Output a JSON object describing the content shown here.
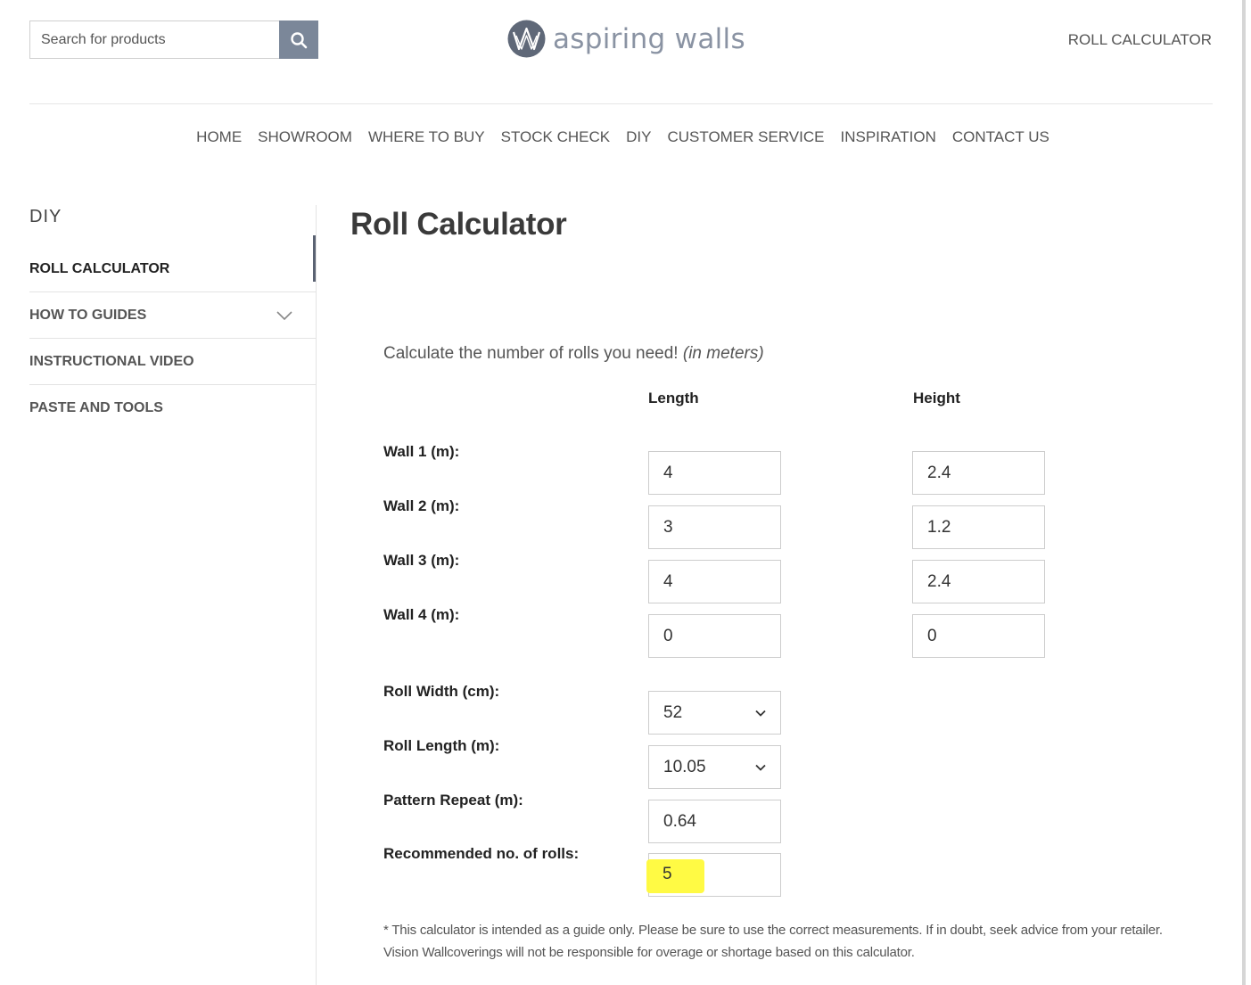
{
  "header": {
    "search_placeholder": "Search for products",
    "logo_text": "aspiring walls",
    "top_link": "ROLL CALCULATOR"
  },
  "nav": [
    "HOME",
    "SHOWROOM",
    "WHERE TO BUY",
    "STOCK CHECK",
    "DIY",
    "CUSTOMER SERVICE",
    "INSPIRATION",
    "CONTACT US"
  ],
  "sidebar": {
    "title": "DIY",
    "items": [
      {
        "label": "ROLL CALCULATOR",
        "active": true
      },
      {
        "label": "HOW TO GUIDES",
        "expandable": true
      },
      {
        "label": "INSTRUCTIONAL VIDEO"
      },
      {
        "label": "PASTE AND TOOLS"
      }
    ]
  },
  "content": {
    "title": "Roll Calculator",
    "intro": "Calculate the number of rolls you need!",
    "intro_units": "(in meters)",
    "col_length": "Length",
    "col_height": "Height",
    "walls": [
      {
        "label": "Wall 1 (m):",
        "length": "4",
        "height": "2.4"
      },
      {
        "label": "Wall 2 (m):",
        "length": "3",
        "height": "1.2"
      },
      {
        "label": "Wall 3 (m):",
        "length": "4",
        "height": "2.4"
      },
      {
        "label": "Wall 4 (m):",
        "length": "0",
        "height": "0"
      }
    ],
    "roll_width_label": "Roll Width (cm):",
    "roll_width_value": "52",
    "roll_length_label": "Roll Length (m):",
    "roll_length_value": "10.05",
    "pattern_repeat_label": "Pattern Repeat (m):",
    "pattern_repeat_value": "0.64",
    "recommended_label": "Recommended no. of rolls:",
    "recommended_value": "5",
    "disclaimer": "* This calculator is intended as a guide only. Please be sure to use the correct measurements. If in doubt, seek advice from your retailer. Vision Wallcoverings will not be responsible for overage or shortage based on this calculator."
  },
  "colors": {
    "accent": "#7b8799",
    "highlight": "#fffa3a"
  }
}
